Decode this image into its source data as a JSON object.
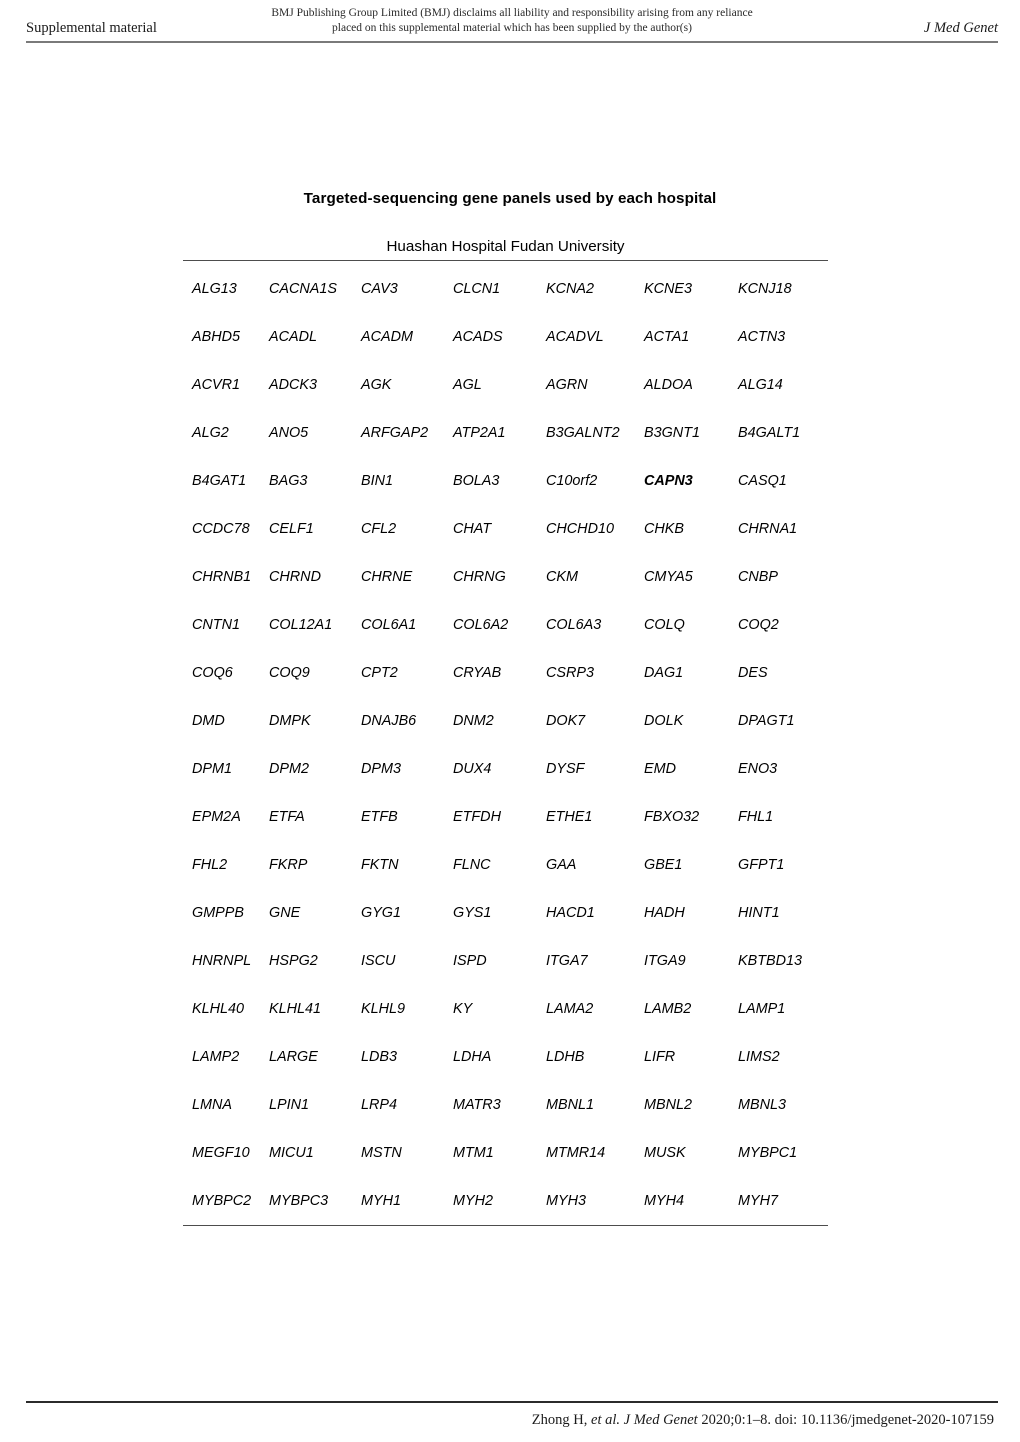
{
  "page_header": {
    "left_label": "Supplemental material",
    "disclaimer_line1": "BMJ Publishing Group Limited (BMJ) disclaims all liability and responsibility arising from any reliance",
    "disclaimer_line2": "placed on this supplemental material which has been supplied by the author(s)",
    "journal": "J Med Genet"
  },
  "document": {
    "title": "Targeted-sequencing gene panels used by each hospital",
    "panel_heading": "Huashan Hospital Fudan University"
  },
  "gene_table": {
    "columns": 7,
    "rows": [
      [
        "ALG13",
        "CACNA1S",
        "CAV3",
        "CLCN1",
        "KCNA2",
        "KCNE3",
        "KCNJ18"
      ],
      [
        "ABHD5",
        "ACADL",
        "ACADM",
        "ACADS",
        "ACADVL",
        "ACTA1",
        "ACTN3"
      ],
      [
        "ACVR1",
        "ADCK3",
        "AGK",
        "AGL",
        "AGRN",
        "ALDOA",
        "ALG14"
      ],
      [
        "ALG2",
        "ANO5",
        "ARFGAP2",
        "ATP2A1",
        "B3GALNT2",
        "B3GNT1",
        "B4GALT1"
      ],
      [
        "B4GAT1",
        "BAG3",
        "BIN1",
        "BOLA3",
        "C10orf2",
        "CAPN3",
        "CASQ1"
      ],
      [
        "CCDC78",
        "CELF1",
        "CFL2",
        "CHAT",
        "CHCHD10",
        "CHKB",
        "CHRNA1"
      ],
      [
        "CHRNB1",
        "CHRND",
        "CHRNE",
        "CHRNG",
        "CKM",
        "CMYA5",
        "CNBP"
      ],
      [
        "CNTN1",
        "COL12A1",
        "COL6A1",
        "COL6A2",
        "COL6A3",
        "COLQ",
        "COQ2"
      ],
      [
        "COQ6",
        "COQ9",
        "CPT2",
        "CRYAB",
        "CSRP3",
        "DAG1",
        "DES"
      ],
      [
        "DMD",
        "DMPK",
        "DNAJB6",
        "DNM2",
        "DOK7",
        "DOLK",
        "DPAGT1"
      ],
      [
        "DPM1",
        "DPM2",
        "DPM3",
        "DUX4",
        "DYSF",
        "EMD",
        "ENO3"
      ],
      [
        "EPM2A",
        "ETFA",
        "ETFB",
        "ETFDH",
        "ETHE1",
        "FBXO32",
        "FHL1"
      ],
      [
        "FHL2",
        "FKRP",
        "FKTN",
        "FLNC",
        "GAA",
        "GBE1",
        "GFPT1"
      ],
      [
        "GMPPB",
        "GNE",
        "GYG1",
        "GYS1",
        "HACD1",
        "HADH",
        "HINT1"
      ],
      [
        "HNRNPL",
        "HSPG2",
        "ISCU",
        "ISPD",
        "ITGA7",
        "ITGA9",
        "KBTBD13"
      ],
      [
        "KLHL40",
        "KLHL41",
        "KLHL9",
        "KY",
        "LAMA2",
        "LAMB2",
        "LAMP1"
      ],
      [
        "LAMP2",
        "LARGE",
        "LDB3",
        "LDHA",
        "LDHB",
        "LIFR",
        "LIMS2"
      ],
      [
        "LMNA",
        "LPIN1",
        "LRP4",
        "MATR3",
        "MBNL1",
        "MBNL2",
        "MBNL3"
      ],
      [
        "MEGF10",
        "MICU1",
        "MSTN",
        "MTM1",
        "MTMR14",
        "MUSK",
        "MYBPC1"
      ],
      [
        "MYBPC2",
        "MYBPC3",
        "MYH1",
        "MYH2",
        "MYH3",
        "MYH4",
        "MYH7"
      ]
    ],
    "bold_cells": [
      "CAPN3"
    ]
  },
  "page_footer": {
    "author": "Zhong H,",
    "et_al_journal": "et al. J Med Genet",
    "citation": "2020;0:1–8. doi: 10.1136/jmedgenet-2020-107159"
  }
}
